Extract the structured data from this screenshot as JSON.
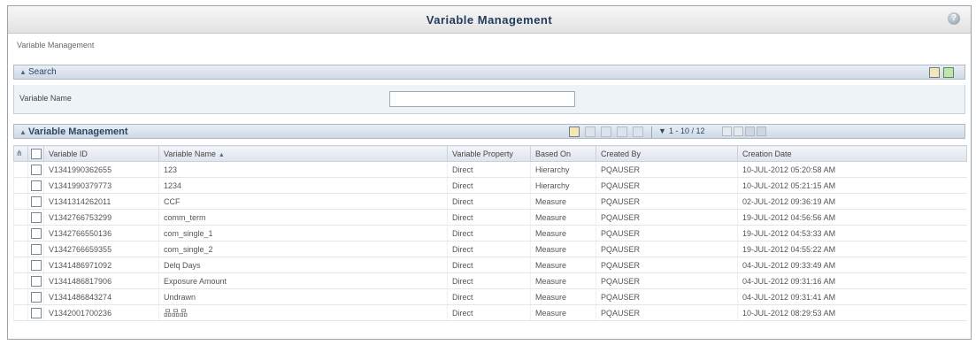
{
  "window": {
    "title": "Variable Management",
    "help_icon": "help-icon"
  },
  "breadcrumb": "Variable Management",
  "search": {
    "header": "Search",
    "field_label": "Variable Name",
    "field_value": "",
    "field_placeholder": "",
    "icons": [
      "search-icon",
      "reset-icon"
    ]
  },
  "grid": {
    "header": "Variable Management",
    "toolbar_icons": [
      "add-icon",
      "view-icon",
      "edit-icon",
      "copy-icon",
      "delete-icon"
    ],
    "pager_text": "1 - 10 / 12",
    "columns": [
      "Variable ID",
      "Variable Name",
      "Variable Property",
      "Based On",
      "Created By",
      "Creation Date"
    ],
    "sorted_column": "Variable Name",
    "rows": [
      {
        "id": "V1341990362655",
        "name": "123",
        "property": "Direct",
        "based_on": "Hierarchy",
        "created_by": "PQAUSER",
        "date": "10-JUL-2012 05:20:58 AM"
      },
      {
        "id": "V1341990379773",
        "name": "1234",
        "property": "Direct",
        "based_on": "Hierarchy",
        "created_by": "PQAUSER",
        "date": "10-JUL-2012 05:21:15 AM"
      },
      {
        "id": "V1341314262011",
        "name": "CCF",
        "property": "Direct",
        "based_on": "Measure",
        "created_by": "PQAUSER",
        "date": "02-JUL-2012 09:36:19 AM"
      },
      {
        "id": "V1342766753299",
        "name": "comm_term",
        "property": "Direct",
        "based_on": "Measure",
        "created_by": "PQAUSER",
        "date": "19-JUL-2012 04:56:56 AM"
      },
      {
        "id": "V1342766550136",
        "name": "com_single_1",
        "property": "Direct",
        "based_on": "Measure",
        "created_by": "PQAUSER",
        "date": "19-JUL-2012 04:53:33 AM"
      },
      {
        "id": "V1342766659355",
        "name": "com_single_2",
        "property": "Direct",
        "based_on": "Measure",
        "created_by": "PQAUSER",
        "date": "19-JUL-2012 04:55:22 AM"
      },
      {
        "id": "V1341486971092",
        "name": "Delq Days",
        "property": "Direct",
        "based_on": "Measure",
        "created_by": "PQAUSER",
        "date": "04-JUL-2012 09:33:49 AM"
      },
      {
        "id": "V1341486817906",
        "name": "Exposure Amount",
        "property": "Direct",
        "based_on": "Measure",
        "created_by": "PQAUSER",
        "date": "04-JUL-2012 09:31:16 AM"
      },
      {
        "id": "V1341486843274",
        "name": "Undrawn",
        "property": "Direct",
        "based_on": "Measure",
        "created_by": "PQAUSER",
        "date": "04-JUL-2012 09:31:41 AM"
      },
      {
        "id": "V1342001700236",
        "name": "品品品",
        "property": "Direct",
        "based_on": "Measure",
        "created_by": "PQAUSER",
        "date": "10-JUL-2012 08:29:53 AM"
      }
    ]
  }
}
